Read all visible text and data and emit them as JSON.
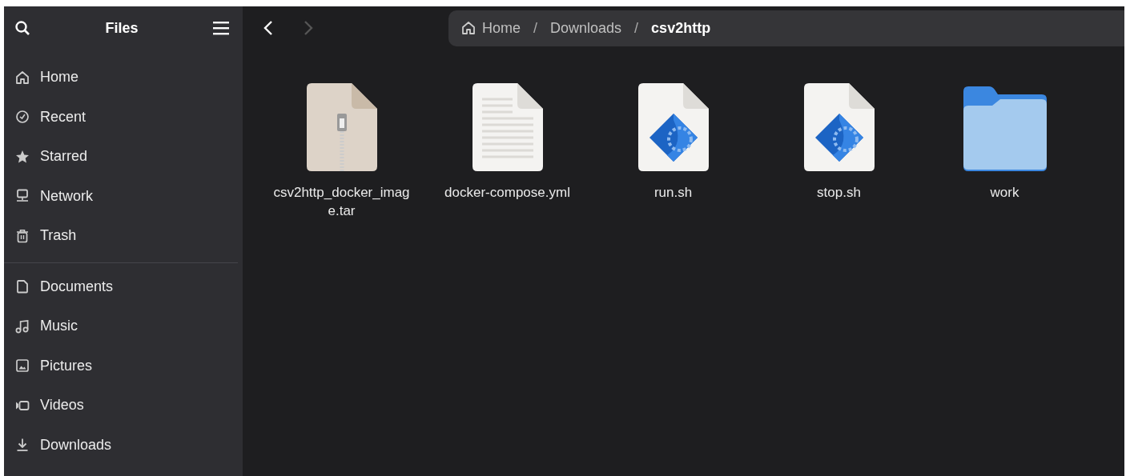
{
  "sidebar": {
    "title": "Files",
    "places": [
      {
        "kind": "home",
        "label": "Home"
      },
      {
        "kind": "recent",
        "label": "Recent"
      },
      {
        "kind": "star",
        "label": "Starred"
      },
      {
        "kind": "network",
        "label": "Network"
      },
      {
        "kind": "trash",
        "label": "Trash"
      }
    ],
    "bookmarks": [
      {
        "kind": "document",
        "label": "Documents"
      },
      {
        "kind": "music",
        "label": "Music"
      },
      {
        "kind": "picture",
        "label": "Pictures"
      },
      {
        "kind": "video",
        "label": "Videos"
      },
      {
        "kind": "download",
        "label": "Downloads"
      }
    ]
  },
  "toolbar": {
    "back_disabled": false,
    "forward_disabled": true,
    "breadcrumb": [
      {
        "kind": "home",
        "label": "Home",
        "selected": false
      },
      {
        "kind": "folder",
        "separator": "/",
        "label": "Downloads",
        "selected": false
      },
      {
        "kind": "folder",
        "separator": "/",
        "label": "csv2http",
        "selected": true
      }
    ]
  },
  "files": [
    {
      "kind": "archive",
      "name": "csv2http_docker_image.tar"
    },
    {
      "kind": "text",
      "name": "docker-compose.yml"
    },
    {
      "kind": "script",
      "name": "run.sh"
    },
    {
      "kind": "script",
      "name": "stop.sh"
    },
    {
      "kind": "folder",
      "name": "work"
    }
  ]
}
